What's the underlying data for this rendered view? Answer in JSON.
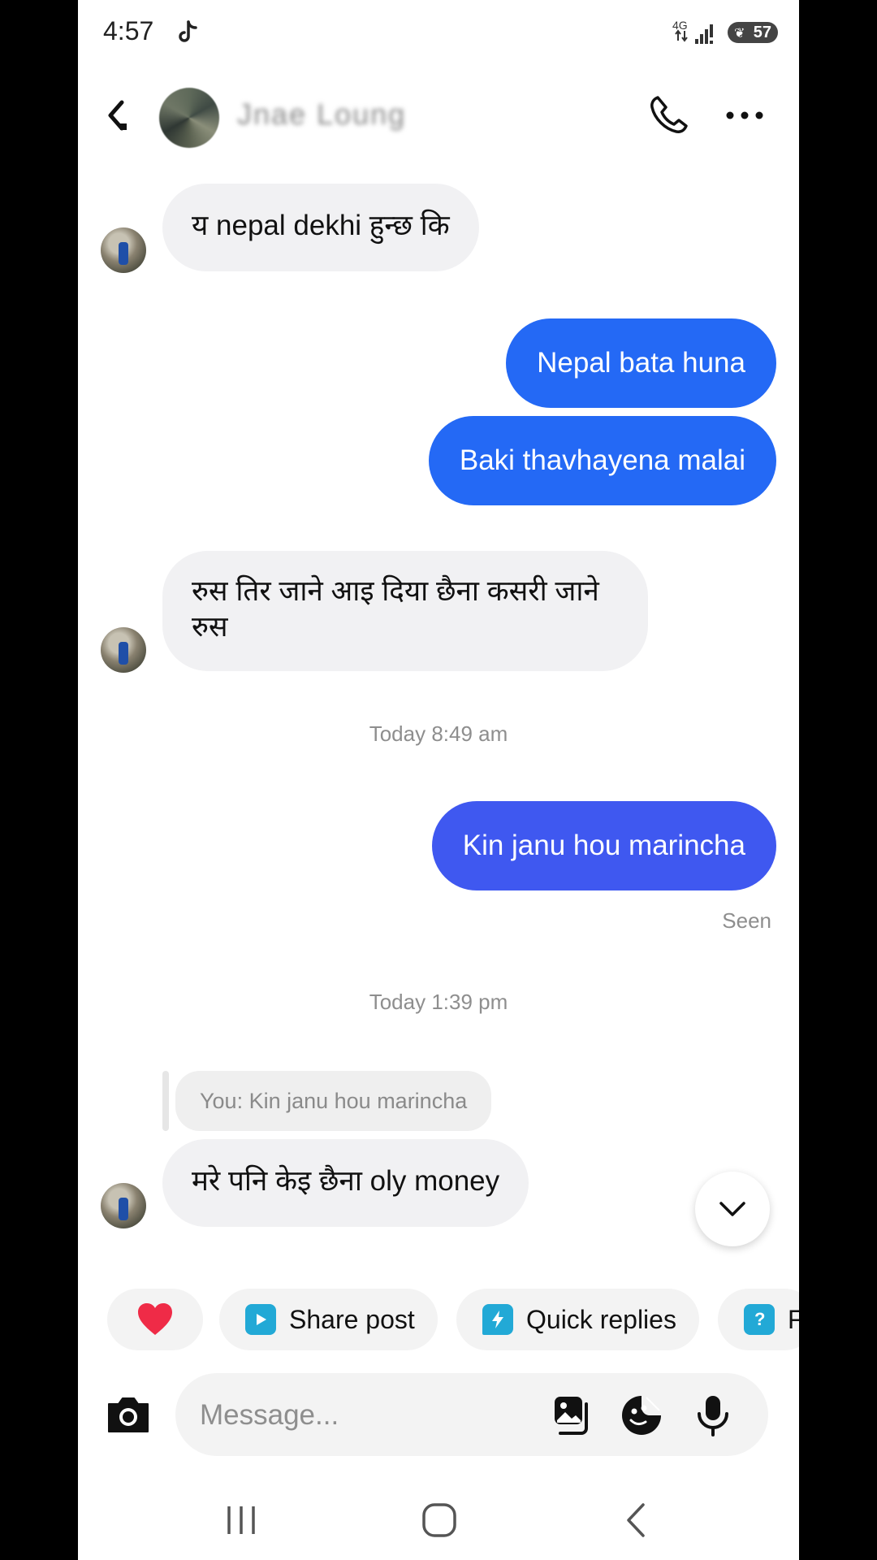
{
  "status_bar": {
    "time": "4:57",
    "network": "4G",
    "battery": "57"
  },
  "header": {
    "contact_name": "Jnae Loung"
  },
  "messages": [
    {
      "direction": "incoming",
      "text": "य nepal dekhi हुन्छ कि"
    },
    {
      "direction": "outgoing",
      "text": "Nepal bata huna"
    },
    {
      "direction": "outgoing",
      "text": "Baki thavhayena malai"
    },
    {
      "direction": "incoming",
      "text": "रुस तिर जाने आइ दिया छैना कसरी जाने रुस"
    },
    {
      "direction": "timestamp",
      "text": "Today 8:49 am"
    },
    {
      "direction": "outgoing",
      "text": "Kin janu hou marincha"
    },
    {
      "direction": "status",
      "text": "Seen"
    },
    {
      "direction": "timestamp",
      "text": "Today 1:39 pm"
    },
    {
      "direction": "reply_preview",
      "text": "You: Kin janu hou marincha"
    },
    {
      "direction": "incoming",
      "text": "मरे पनि केइ छैना oly money"
    }
  ],
  "chips": [
    {
      "label": "",
      "icon": "heart-icon"
    },
    {
      "label": "Share post",
      "icon": "play-square-icon"
    },
    {
      "label": "Quick replies",
      "icon": "bolt-bubble-icon"
    },
    {
      "label": "F",
      "icon": "question-bubble-icon"
    }
  ],
  "composer": {
    "placeholder": "Message..."
  },
  "colors": {
    "outgoing_bubble": "#2469f5",
    "outgoing_bubble_alt": "#3f58f0",
    "incoming_bubble": "#f1f1f3",
    "heart": "#ef2b47",
    "chip_icon": "#22a9d6"
  }
}
